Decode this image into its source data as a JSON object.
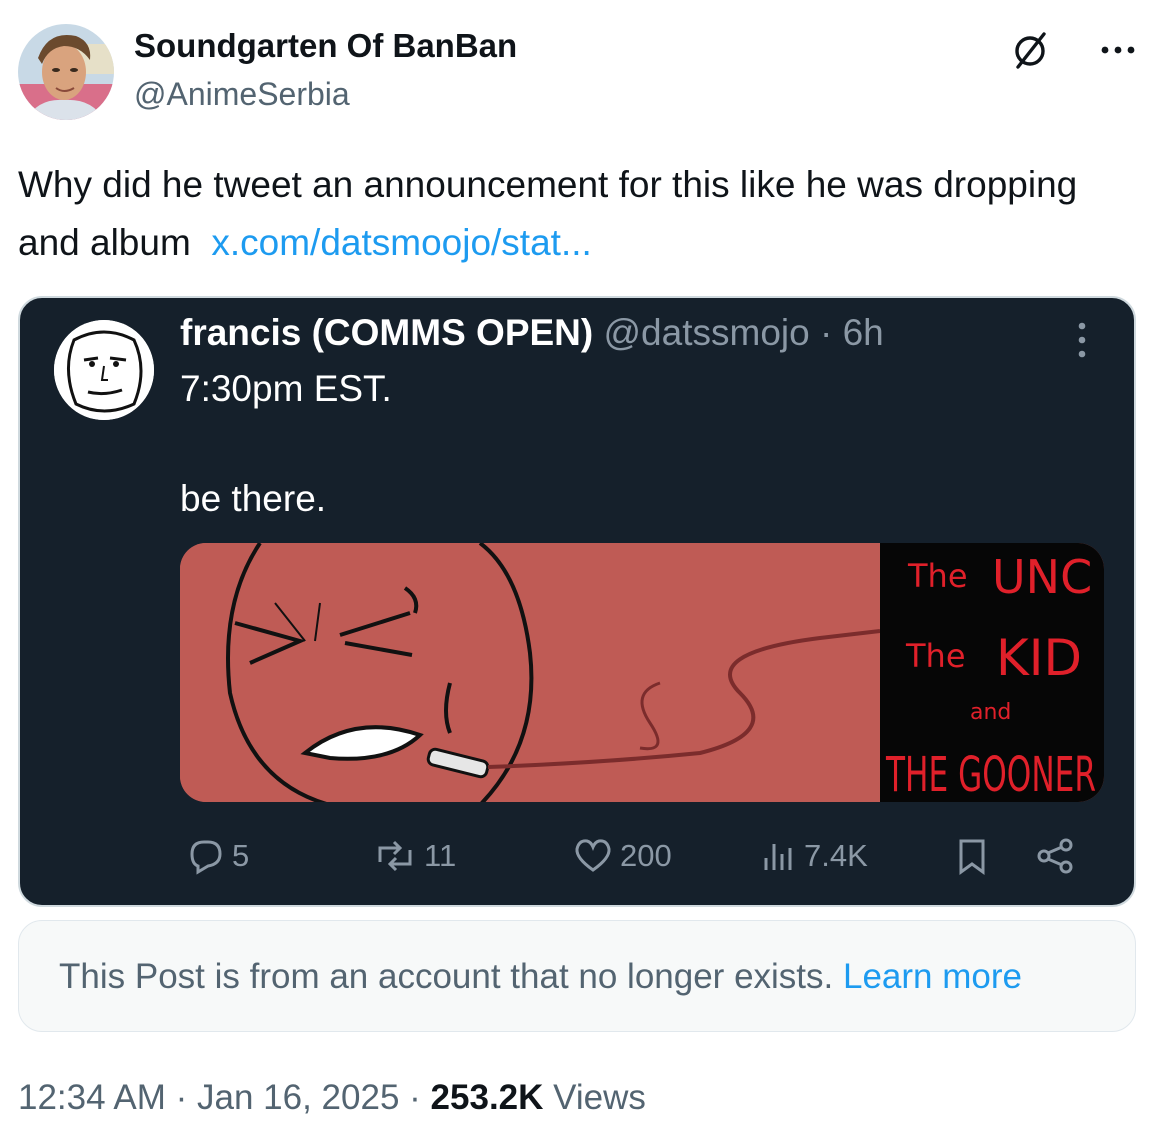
{
  "author": {
    "display_name": "Soundgarten Of BanBan",
    "handle": "@AnimeSerbia",
    "avatar_icon": "user-avatar"
  },
  "tweet": {
    "text": "Why did he tweet an announcement for this like he was dropping and album",
    "link_text": "x.com/datsmoojo/stat..."
  },
  "quoted": {
    "display_name": "francis (COMMS OPEN)",
    "handle": "@datssmojo",
    "separator": "·",
    "age": "6h",
    "line1": "7:30pm EST.",
    "line2": "be there.",
    "media_alt_text": {
      "line1_a": "The",
      "line1_b": "UNC",
      "line2_a": "The",
      "line2_b": "KID",
      "line3": "and",
      "line4": "THE GOONER"
    },
    "actions": {
      "replies": "5",
      "reposts": "11",
      "likes": "200",
      "views": "7.4K"
    }
  },
  "notice": {
    "text": "This Post is from an account that no longer exists.",
    "link": "Learn more"
  },
  "footer": {
    "time": "12:34 AM",
    "sep1": "·",
    "date": "Jan 16, 2025",
    "sep2": "·",
    "views": "253.2K",
    "views_label": "Views"
  },
  "colors": {
    "link": "#1d9bf0",
    "card_bg": "#15202b",
    "media_red": "#bf5b55",
    "muted": "#536471"
  }
}
